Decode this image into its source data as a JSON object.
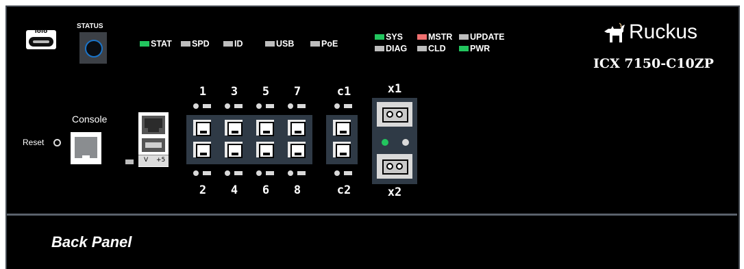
{
  "device": {
    "brand": "Ruckus",
    "model": "ICX 7150-C10ZP",
    "panel_label": "Back Panel"
  },
  "front": {
    "usbc_label": "ıоıо",
    "status_label": "STATUS",
    "reset_label": "Reset",
    "console_label": "Console",
    "power_marks": [
      "V",
      "+5"
    ]
  },
  "leds": {
    "stat": {
      "label": "STAT",
      "color": "#22c55e"
    },
    "spd": {
      "label": "SPD",
      "color": "#bdbdbd"
    },
    "id": {
      "label": "ID",
      "color": "#bdbdbd"
    },
    "usb": {
      "label": "USB",
      "color": "#bdbdbd"
    },
    "poe": {
      "label": "PoE",
      "color": "#bdbdbd"
    },
    "sys": {
      "label": "SYS",
      "color": "#22c55e"
    },
    "mstr": {
      "label": "MSTR",
      "color": "#f07070"
    },
    "update": {
      "label": "UPDATE",
      "color": "#bdbdbd"
    },
    "diag": {
      "label": "DIAG",
      "color": "#bdbdbd"
    },
    "cld": {
      "label": "CLD",
      "color": "#bdbdbd"
    },
    "pwr": {
      "label": "PWR",
      "color": "#22c55e"
    }
  },
  "ports": {
    "top": [
      "1",
      "3",
      "5",
      "7",
      "c1"
    ],
    "bottom": [
      "2",
      "4",
      "6",
      "8",
      "c2"
    ],
    "sfp_top": "x1",
    "sfp_bottom": "x2"
  },
  "sfp_link_leds": {
    "left": "#22c55e",
    "right": "#d9d9d9"
  }
}
